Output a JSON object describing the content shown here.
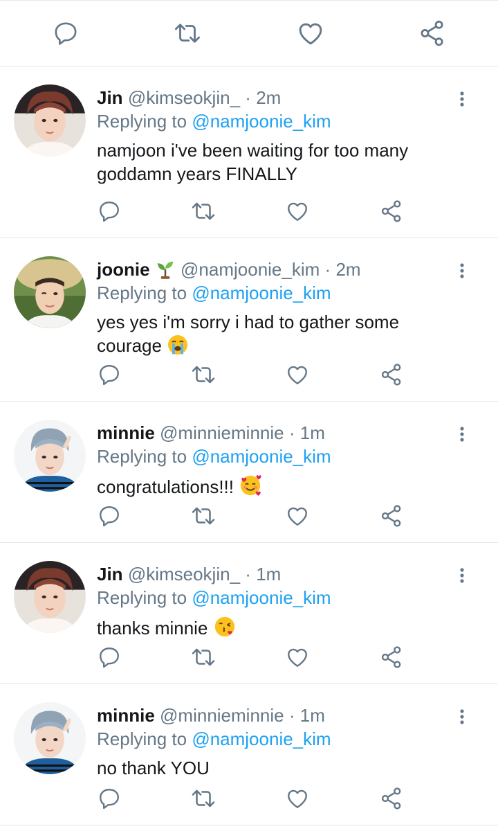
{
  "colors": {
    "link": "#1da1f2",
    "muted": "#657786",
    "text": "#14171a",
    "divider": "#e1e8ed"
  },
  "top_actions": [
    "reply-icon",
    "retweet-icon",
    "like-icon",
    "share-icon"
  ],
  "tweets": [
    {
      "name": "Jin",
      "name_emoji": "",
      "handle": "@kimseokjin_",
      "sep": "·",
      "time": "2m",
      "reply_prefix": "Replying to",
      "reply_to": "@namjoonie_kim",
      "text": "namjoon i've been waiting for too many goddamn years FINALLY",
      "text_emoji": ""
    },
    {
      "name": "joonie",
      "name_emoji": "seedling",
      "handle": "@namjoonie_kim",
      "sep": "·",
      "time": "2m",
      "reply_prefix": "Replying to",
      "reply_to": "@namjoonie_kim",
      "text": "yes yes i'm sorry i had to gather some courage",
      "text_emoji": "loudly-crying"
    },
    {
      "name": "minnie",
      "name_emoji": "",
      "handle": "@minnieminnie",
      "sep": "·",
      "time": "1m",
      "reply_prefix": "Replying to",
      "reply_to": "@namjoonie_kim",
      "text": "congratulations!!!",
      "text_emoji": "smiling-with-hearts"
    },
    {
      "name": "Jin",
      "name_emoji": "",
      "handle": "@kimseokjin_",
      "sep": "·",
      "time": "1m",
      "reply_prefix": "Replying to",
      "reply_to": "@namjoonie_kim",
      "text": "thanks minnie",
      "text_emoji": "face-blowing-kiss"
    },
    {
      "name": "minnie",
      "name_emoji": "",
      "handle": "@minnieminnie",
      "sep": "·",
      "time": "1m",
      "reply_prefix": "Replying to",
      "reply_to": "@namjoonie_kim",
      "text": "no thank YOU",
      "text_emoji": ""
    }
  ]
}
